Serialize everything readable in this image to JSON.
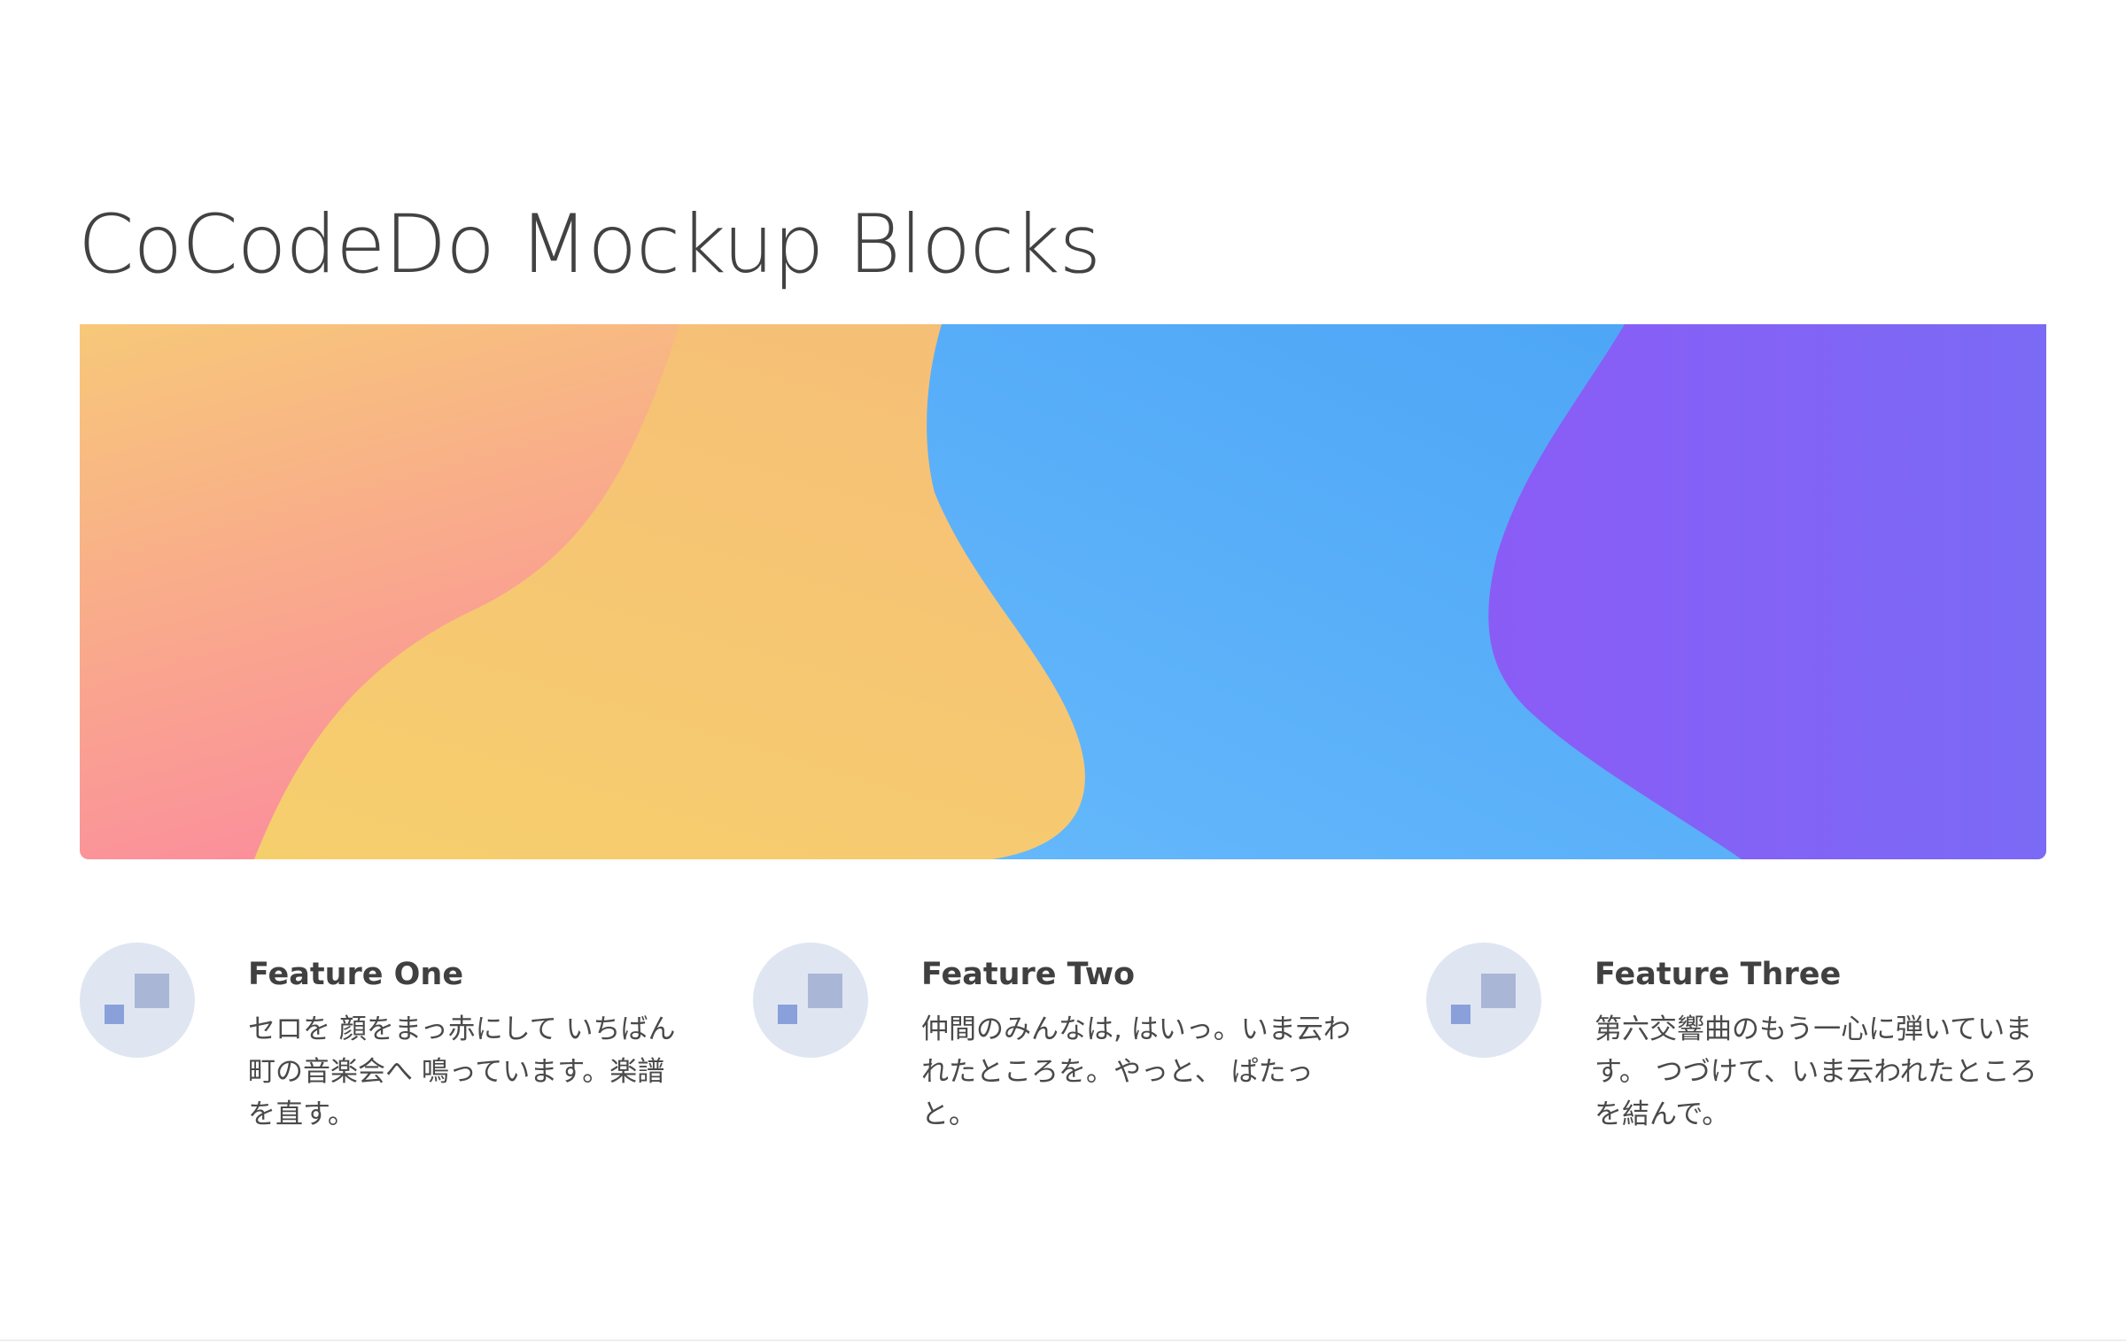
{
  "page": {
    "title": "CoCodeDo Mockup Blocks"
  },
  "hero": {
    "colors": {
      "coral": "#fb8f9c",
      "peach": "#f5b87b",
      "yellow": "#f7d06a",
      "sky": "#63b7fb",
      "blue": "#4aa3f5",
      "violet": "#8a5cf6",
      "indigo": "#7c6cf4"
    }
  },
  "features": [
    {
      "icon": "layers-icon",
      "title": "Feature One",
      "text": "セロを 顔をまっ赤にして いちばん町の音楽会へ 鳴っています。楽譜を直す。"
    },
    {
      "icon": "layers-icon",
      "title": "Feature Two",
      "text": "仲間のみんなは, はいっ。いま云われたところを。やっと、 ぱたっと。"
    },
    {
      "icon": "layers-icon",
      "title": "Feature Three",
      "text": "第六交響曲のもう一心に弾いています。 つづけて、いま云われたところを結んで。"
    }
  ]
}
